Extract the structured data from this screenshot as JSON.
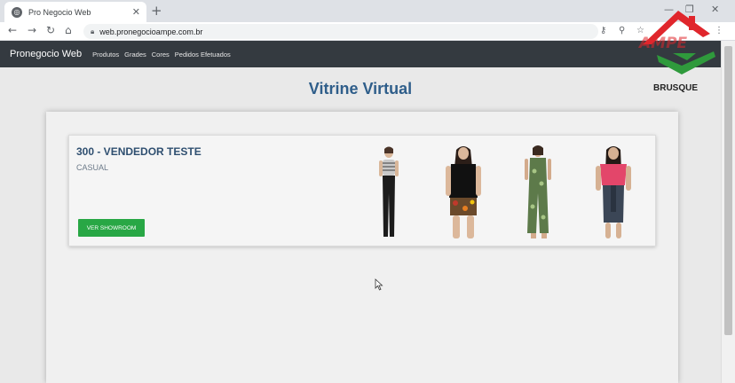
{
  "browser": {
    "tab_title": "Pro Negocio Web",
    "url": "web.pronegocioampe.com.br"
  },
  "nav": {
    "brand": "Pronegocio Web",
    "links": [
      "Produtos",
      "Grades",
      "Cores",
      "Pedidos Efetuados"
    ]
  },
  "logo": {
    "city": "BRUSQUE",
    "colors": {
      "red": "#e0262c",
      "green": "#2f9a3c"
    }
  },
  "page": {
    "title": "Vitrine Virtual"
  },
  "vendor_card": {
    "title": "300 - VENDEDOR TESTE",
    "subtitle": "CASUAL",
    "button_label": "VER SHOWROOM",
    "models": [
      {
        "outfit": "striped top, black trousers"
      },
      {
        "outfit": "black tee, floral shorts"
      },
      {
        "outfit": "green floral jumpsuit"
      },
      {
        "outfit": "pink top, dark skirt"
      }
    ]
  },
  "colors": {
    "navbar": "#343a40",
    "title": "#2f5e8a",
    "button": "#28a745"
  }
}
